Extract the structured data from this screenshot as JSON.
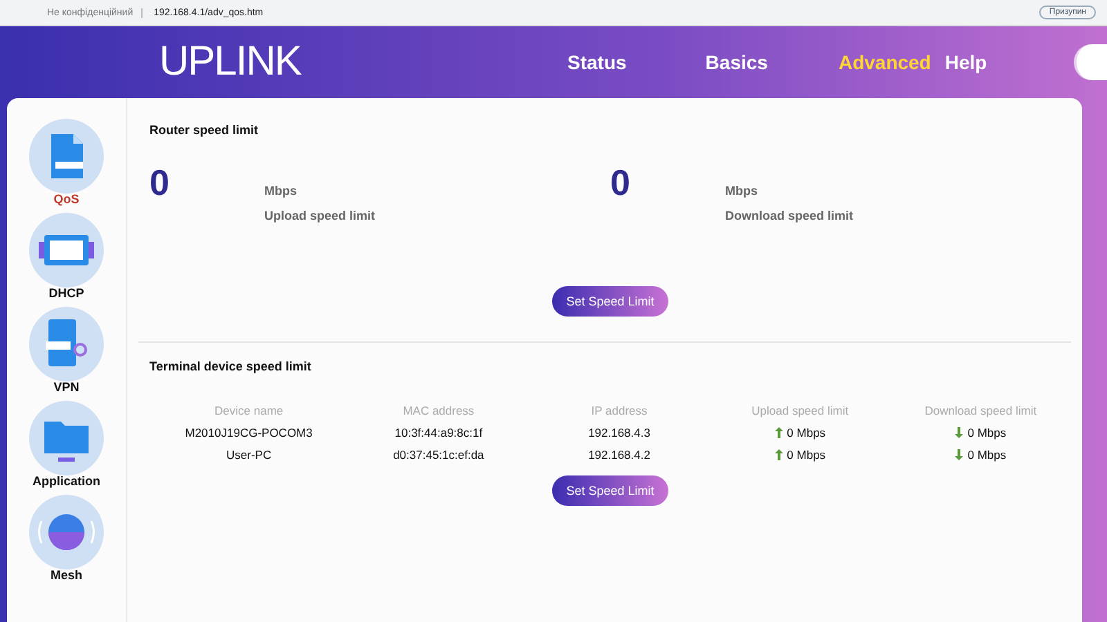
{
  "browser": {
    "security": "Не конфіденційний",
    "url": "192.168.4.1/adv_qos.htm",
    "profile": "Призупин"
  },
  "header": {
    "logo": "UPLINK",
    "nav": [
      {
        "label": "Status",
        "selected": false
      },
      {
        "label": "Basics",
        "selected": false
      },
      {
        "label": "Advanced",
        "selected": true
      },
      {
        "label": "Help",
        "selected": false
      }
    ]
  },
  "sidebar": {
    "items": [
      {
        "label": "QoS",
        "kind": "doc",
        "selected": true
      },
      {
        "label": "DHCP",
        "kind": "board",
        "selected": false
      },
      {
        "label": "VPN",
        "kind": "vpn",
        "selected": false
      },
      {
        "label": "Application",
        "kind": "folder",
        "selected": false
      },
      {
        "label": "Mesh",
        "kind": "globe",
        "selected": false
      }
    ]
  },
  "router_limit": {
    "title": "Router speed limit",
    "items": [
      {
        "value": "0",
        "unit": "Mbps",
        "label": "Upload speed limit"
      },
      {
        "value": "0",
        "unit": "Mbps",
        "label": "Download speed limit"
      }
    ],
    "button": "Set Speed Limit"
  },
  "terminal_limit": {
    "title": "Terminal device speed limit",
    "columns": [
      "Device name",
      "MAC address",
      "IP address",
      "Upload speed limit",
      "Download speed limit"
    ],
    "rows": [
      [
        "M2010J19CG-POCOM3",
        "10:3f:44:a9:8c:1f",
        "192.168.4.3",
        "0 Mbps",
        "0 Mbps"
      ],
      [
        "User-PC",
        "d0:37:45:1c:ef:da",
        "192.168.4.2",
        "0 Mbps",
        "0 Mbps"
      ]
    ],
    "button": "Set Speed Limit"
  }
}
